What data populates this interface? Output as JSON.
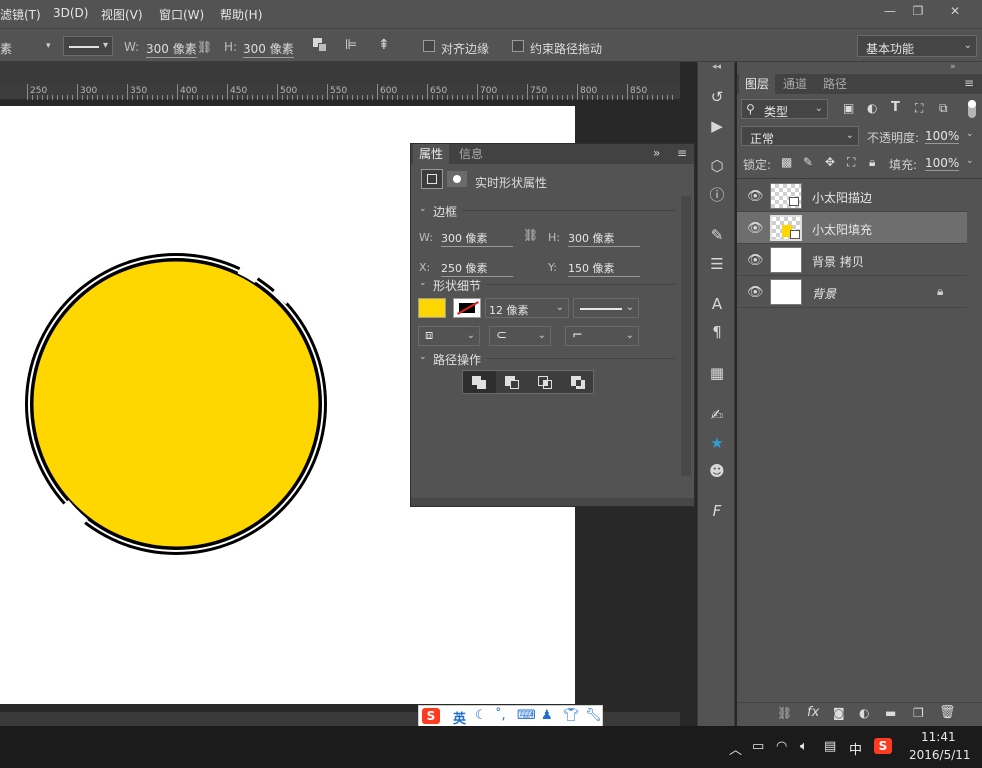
{
  "menu": {
    "items": [
      "滤镜(T)",
      "3D(D)",
      "视图(V)",
      "窗口(W)",
      "帮助(H)"
    ],
    "window_controls": [
      "—",
      "❐",
      "✕"
    ]
  },
  "options": {
    "unit_partial": "素",
    "w_label": "W:",
    "w_value": "300 像素",
    "h_label": "H:",
    "h_value": "300 像素",
    "align_edges": "对齐边缘",
    "constrain_path": "约束路径拖动",
    "workspace": "基本功能"
  },
  "ruler": {
    "labels": [
      "250",
      "300",
      "350",
      "400",
      "450",
      "500",
      "550",
      "600",
      "650",
      "700",
      "750",
      "800",
      "850"
    ]
  },
  "colors": {
    "fill": "#ffd700",
    "stroke": "#000000",
    "canvas": "#ffffff",
    "panel": "#535353",
    "accent_blue": "#2f9fd8",
    "ime_logo": "#ff3b1f"
  },
  "properties": {
    "tabs": [
      "属性",
      "信息"
    ],
    "header_label": "实时形状属性",
    "sections": {
      "border": "边框",
      "shape_details": "形状细节",
      "path_ops": "路径操作"
    },
    "w_label": "W:",
    "w_value": "300 像素",
    "h_label": "H:",
    "h_value": "300 像素",
    "x_label": "X:",
    "x_value": "250 像素",
    "y_label": "Y:",
    "y_value": "150 像素",
    "stroke_width": "12 像素",
    "collapse": "»"
  },
  "layers_panel": {
    "tabs": [
      "图层",
      "通道",
      "路径"
    ],
    "filter_kind": "类型",
    "blend_mode": "正常",
    "opacity_label": "不透明度:",
    "opacity_value": "100%",
    "lock_label": "锁定:",
    "fill_label": "填充:",
    "fill_value": "100%",
    "layers": [
      {
        "name": "小太阳描边",
        "selected": false
      },
      {
        "name": "小太阳填充",
        "selected": true
      },
      {
        "name": "背景 拷贝",
        "selected": false
      },
      {
        "name": "背景",
        "selected": false
      }
    ],
    "footer_icons": [
      "link-icon",
      "fx-icon",
      "mask-icon",
      "adjustment-icon",
      "folder-icon",
      "new-layer-icon",
      "trash-icon"
    ],
    "footer_fx": "fx"
  },
  "ime": {
    "logo": "S",
    "lang": "英"
  },
  "taskbar": {
    "ime_mode": "中",
    "time": "11:41",
    "date": "2016/5/11"
  }
}
